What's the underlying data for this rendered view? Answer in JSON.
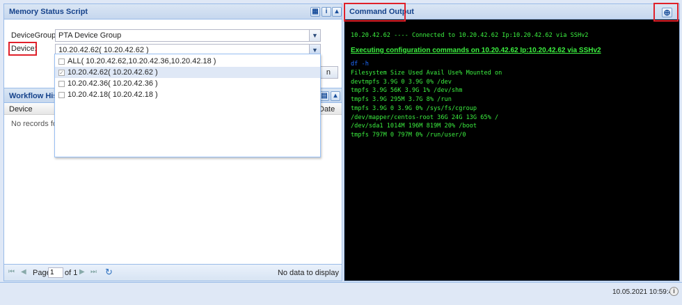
{
  "left_panel": {
    "title": "Memory Status Script",
    "buttons": {
      "grid_icon": "▦",
      "info_icon": "i",
      "collapse_icon": "▴"
    }
  },
  "form": {
    "device_group_label": "DeviceGroup:",
    "device_group_value": "PTA Device Group",
    "device_label": "Device:",
    "device_value": "10.20.42.62( 10.20.42.62 )"
  },
  "dropdown": {
    "items": [
      {
        "label": "ALL( 10.20.42.62,10.20.42.36,10.20.42.18 )",
        "checked": false
      },
      {
        "label": "10.20.42.62( 10.20.42.62 )",
        "checked": true
      },
      {
        "label": "10.20.42.36( 10.20.42.36 )",
        "checked": false
      },
      {
        "label": "10.20.42.18( 10.20.42.18 )",
        "checked": false
      }
    ],
    "behind_button_fragment": "n"
  },
  "workflow": {
    "title": "Workflow History",
    "col_device": "Device",
    "col_date": "Date",
    "empty_text": "No records found"
  },
  "pager": {
    "page_label": "Page",
    "page_value": "1",
    "of_label": "of 1",
    "no_data": "No data to display"
  },
  "right_panel": {
    "title": "Command Output",
    "expand_icon": "⊕"
  },
  "console": {
    "connected": "10.20.42.62 ---- Connected to 10.20.42.62 Ip:10.20.42.62 via SSHv2",
    "executing": "Executing configuration commands on 10.20.42.62 Ip:10.20.42.62 via SSHv2",
    "command": "df -h",
    "output": [
      "Filesystem Size Used Avail Use% Mounted on",
      "devtmpfs 3.9G 0 3.9G 0% /dev",
      "tmpfs 3.9G 56K 3.9G 1% /dev/shm",
      "tmpfs 3.9G 295M 3.7G 8% /run",
      "tmpfs 3.9G 0 3.9G 0% /sys/fs/cgroup",
      "/dev/mapper/centos-root 36G 24G 13G 65% /",
      "/dev/sda1 1014M 196M 819M 20% /boot",
      "tmpfs 797M 0 797M 0% /run/user/0"
    ],
    "colors": {
      "text": "#3cf040",
      "command": "#1e6cff",
      "background": "#000000"
    }
  },
  "status_bar": {
    "timestamp": "10.05.2021 10:59:42",
    "info_icon": "i"
  },
  "colors": {
    "highlight": "#e0202a",
    "header_text": "#15428b"
  }
}
